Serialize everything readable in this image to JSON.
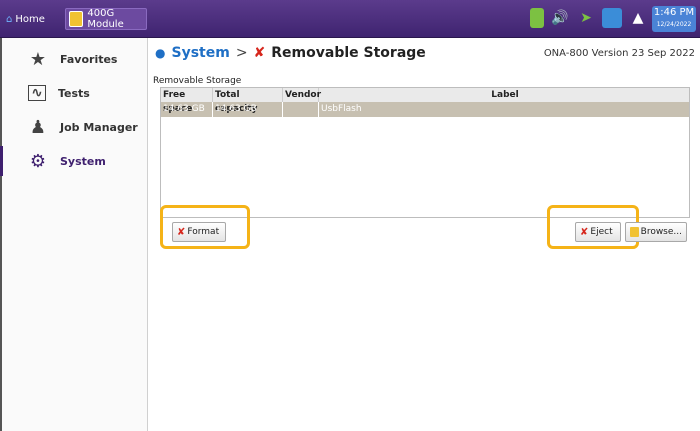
{
  "topbar": {
    "home_label": "Home",
    "module_label": "400G Module",
    "clock_time": "1:46 PM",
    "clock_date": "12/24/2022",
    "status_colors": [
      "#7cc142",
      "#ffffff",
      "#7cc142",
      "#3b8dd8",
      "#ffffff"
    ]
  },
  "sidebar": {
    "items": [
      {
        "label": "Favorites",
        "icon": "star-icon"
      },
      {
        "label": "Tests",
        "icon": "tests-icon"
      },
      {
        "label": "Job Manager",
        "icon": "job-manager-icon"
      },
      {
        "label": "System",
        "icon": "gear-icon"
      }
    ]
  },
  "header": {
    "crumb_system": "System",
    "crumb_separator": ">",
    "crumb_page": "Removable Storage",
    "version": "ONA-800 Version 23 Sep 2022"
  },
  "panel": {
    "title": "Removable Storage",
    "columns": [
      "Free space",
      "Total capacity",
      "Vendor",
      "Label"
    ],
    "rows": [
      {
        "free_space": "14.63 GB",
        "total_capacity": "14.63 GB",
        "vendor": "",
        "label": "UsbFlash"
      }
    ]
  },
  "buttons": {
    "format": "Format",
    "eject": "Eject",
    "browse": "Browse..."
  },
  "colors": {
    "accent": "#3e1f6e",
    "highlight": "#f5b317",
    "selected_row": "#c7c0b1"
  }
}
